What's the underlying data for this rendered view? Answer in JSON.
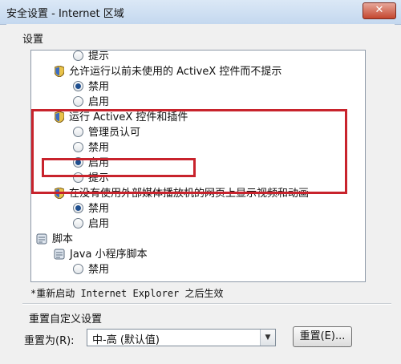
{
  "window": {
    "title": "安全设置 - Internet 区域",
    "close_glyph": "✕"
  },
  "settings_group": {
    "label": "设置"
  },
  "list": {
    "rows": [
      {
        "kind": "radio",
        "label": "提示",
        "checked": false
      },
      {
        "kind": "shield",
        "label": "允许运行以前未使用的 ActiveX 控件而不提示"
      },
      {
        "kind": "radio",
        "label": "禁用",
        "checked": true
      },
      {
        "kind": "radio",
        "label": "启用",
        "checked": false
      },
      {
        "kind": "shield",
        "label": "运行 ActiveX 控件和插件"
      },
      {
        "kind": "radio",
        "label": "管理员认可",
        "checked": false
      },
      {
        "kind": "radio",
        "label": "禁用",
        "checked": false
      },
      {
        "kind": "radio",
        "label": "启用",
        "checked": true
      },
      {
        "kind": "radio",
        "label": "提示",
        "checked": false
      },
      {
        "kind": "shield",
        "label": "在没有使用外部媒体播放机的网页上显示视频和动画"
      },
      {
        "kind": "radio",
        "label": "禁用",
        "checked": true
      },
      {
        "kind": "radio",
        "label": "启用",
        "checked": false
      },
      {
        "kind": "script",
        "label": "脚本"
      },
      {
        "kind": "script",
        "label": "Java 小程序脚本"
      },
      {
        "kind": "radio",
        "label": "禁用",
        "checked": false
      }
    ]
  },
  "note": "*重新启动 Internet Explorer 之后生效",
  "reset": {
    "group_label": "重置自定义设置",
    "label": "重置为(R):",
    "selected": "中-高 (默认值)",
    "button": "重置(E)..."
  },
  "colors": {
    "highlight_box": "#c8232c",
    "title_gradient_top": "#dbe8f6"
  }
}
